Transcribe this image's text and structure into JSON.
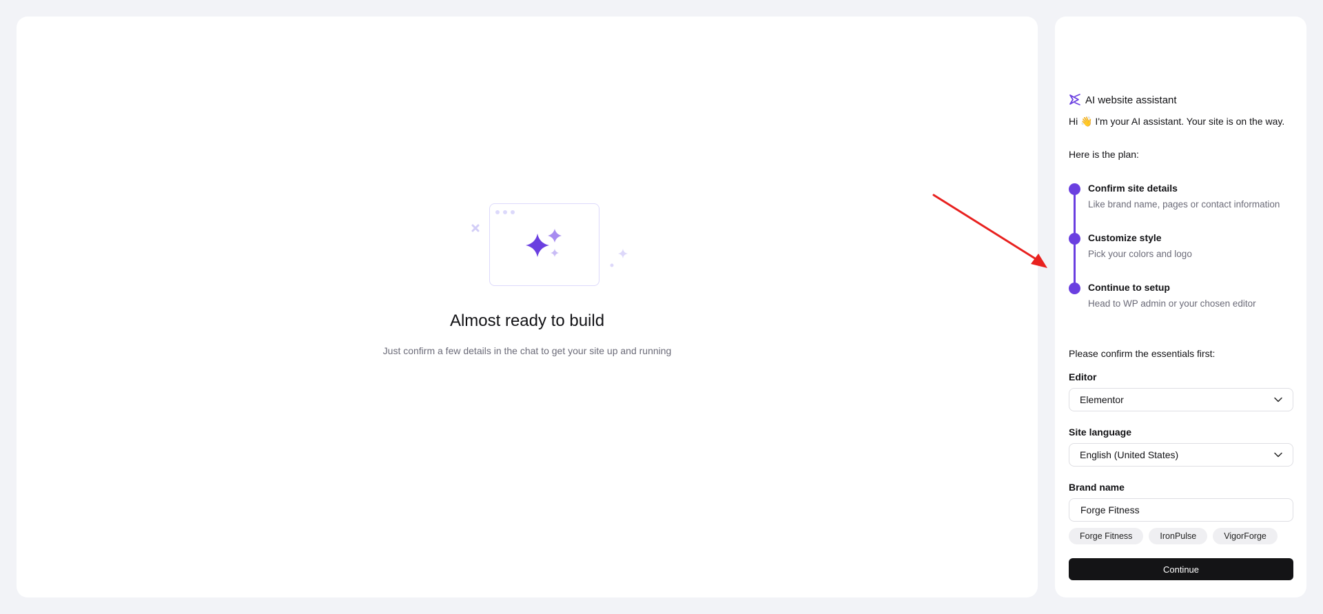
{
  "main": {
    "title": "Almost ready to build",
    "subtitle": "Just confirm a few details in the chat to get your site up and running"
  },
  "assistant": {
    "header": "AI website assistant",
    "greeting": "Hi 👋 I'm your AI assistant. Your site is on the way.",
    "plan_intro": "Here is the plan:",
    "steps": [
      {
        "title": "Confirm site details",
        "description": "Like brand name, pages or contact information"
      },
      {
        "title": "Customize style",
        "description": "Pick your colors and logo"
      },
      {
        "title": "Continue to setup",
        "description": "Head to WP admin or your chosen editor"
      }
    ],
    "confirm_intro": "Please confirm the essentials first:",
    "editor": {
      "label": "Editor",
      "value": "Elementor"
    },
    "language": {
      "label": "Site language",
      "value": "English (United States)"
    },
    "brand": {
      "label": "Brand name",
      "value": "Forge Fitness",
      "suggestions": [
        "Forge Fitness",
        "IronPulse",
        "VigorForge"
      ]
    },
    "continue_label": "Continue"
  },
  "colors": {
    "accent": "#6a3fe0",
    "arrow": "#e8211f",
    "button": "#141416"
  }
}
